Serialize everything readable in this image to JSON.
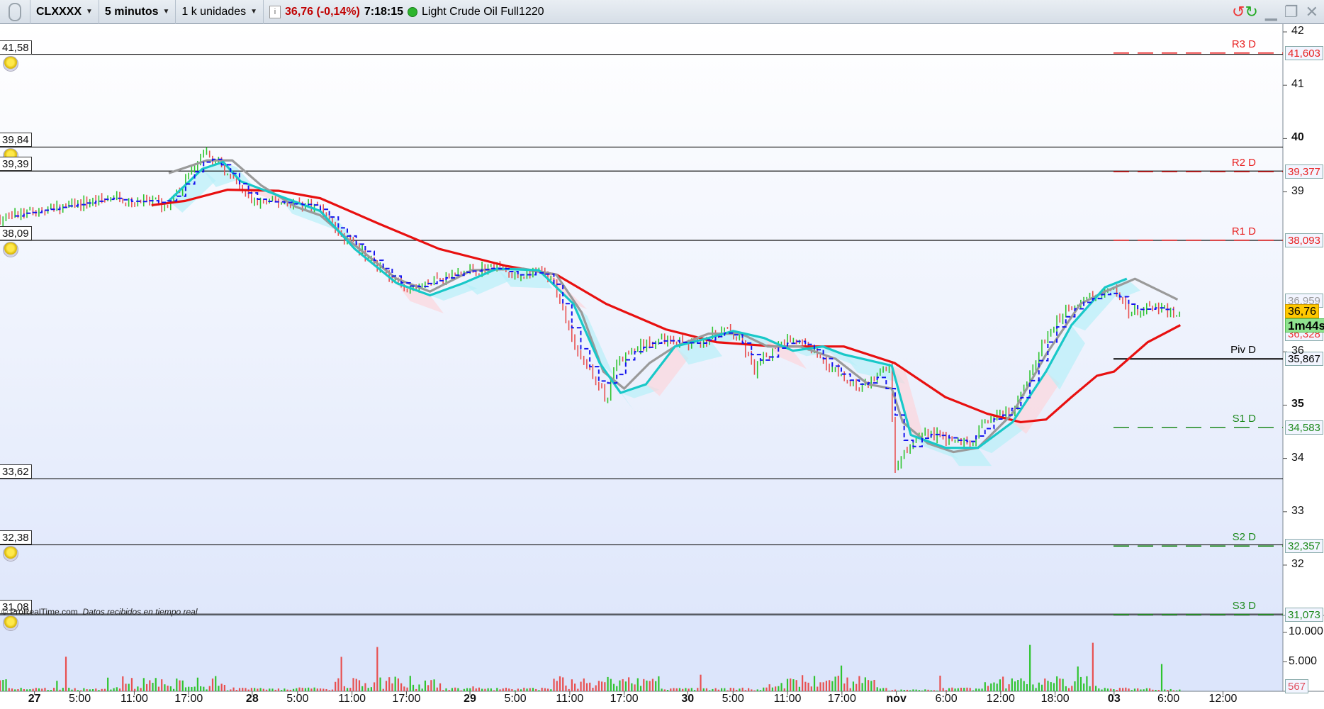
{
  "toolbar": {
    "symbol": "CLXXXX",
    "timeframe": "5 minutos",
    "units": "1 k unidades",
    "price": "36,76 (-0,14%)",
    "time": "7:18:15",
    "instrument": "Light Crude Oil Full1220"
  },
  "icons": {
    "refresh": "refresh-icon",
    "minimize": "minimize-icon",
    "restore": "restore-icon",
    "close": "close-icon"
  },
  "left_levels": [
    {
      "label": "41,58",
      "price": 41.58,
      "bell": true
    },
    {
      "label": "39,84",
      "price": 39.84,
      "bell": true
    },
    {
      "label": "39,39",
      "price": 39.39,
      "bell": false
    },
    {
      "label": "38,09",
      "price": 38.09,
      "bell": true
    },
    {
      "label": "33,62",
      "price": 33.62,
      "bell": false
    },
    {
      "label": "32,38",
      "price": 32.38,
      "bell": true
    },
    {
      "label": "31,08",
      "price": 31.08,
      "bell": true
    }
  ],
  "pivots": [
    {
      "name": "R3 D",
      "value": "41,603",
      "price": 41.603,
      "color": "#e82020",
      "style": "dash"
    },
    {
      "name": "R2 D",
      "value": "39,377",
      "price": 39.377,
      "color": "#e82020",
      "style": "dash"
    },
    {
      "name": "R1 D",
      "value": "38,093",
      "price": 38.093,
      "color": "#e82020",
      "style": "dash"
    },
    {
      "name": "Piv D",
      "value": "35,867",
      "price": 35.867,
      "color": "#000000",
      "style": "solid"
    },
    {
      "name": "S1 D",
      "value": "34,583",
      "price": 34.583,
      "color": "#1e8a1e",
      "style": "dash"
    },
    {
      "name": "S2 D",
      "value": "32,357",
      "price": 32.357,
      "color": "#1e8a1e",
      "style": "dash"
    },
    {
      "name": "S3 D",
      "value": "31,073",
      "price": 31.073,
      "color": "#1e8a1e",
      "style": "dash"
    }
  ],
  "price_labels": {
    "ma_grey": "36,959",
    "last": "36,76",
    "countdown": "1m44s",
    "ma_red": "36,328"
  },
  "watermark": "© ProRealTime.com",
  "watermark_note": "Datos recibidos en tiempo real",
  "chart_data": {
    "type": "candlestick",
    "ylim": [
      31,
      42.1
    ],
    "y_ticks": [
      {
        "v": 42,
        "label": "42"
      },
      {
        "v": 41,
        "label": "41"
      },
      {
        "v": 40,
        "label": "40",
        "bold": true
      },
      {
        "v": 39,
        "label": "39"
      },
      {
        "v": 36,
        "label": "36"
      },
      {
        "v": 35,
        "label": "35",
        "bold": true
      },
      {
        "v": 34,
        "label": "34"
      },
      {
        "v": 33,
        "label": "33"
      },
      {
        "v": 32,
        "label": "32"
      }
    ],
    "x_ticks": [
      {
        "x": 0,
        "label": "27",
        "bold": true
      },
      {
        "x": 5,
        "label": "5:00"
      },
      {
        "x": 11,
        "label": "11:00"
      },
      {
        "x": 17,
        "label": "17:00"
      },
      {
        "x": 24,
        "label": "28",
        "bold": true
      },
      {
        "x": 29,
        "label": "5:00"
      },
      {
        "x": 35,
        "label": "11:00"
      },
      {
        "x": 41,
        "label": "17:00"
      },
      {
        "x": 48,
        "label": "29",
        "bold": true
      },
      {
        "x": 53,
        "label": "5:00"
      },
      {
        "x": 59,
        "label": "11:00"
      },
      {
        "x": 65,
        "label": "17:00"
      },
      {
        "x": 72,
        "label": "30",
        "bold": true
      },
      {
        "x": 77,
        "label": "5:00"
      },
      {
        "x": 83,
        "label": "11:00"
      },
      {
        "x": 89,
        "label": "17:00"
      },
      {
        "x": 95,
        "label": "nov",
        "bold": true
      },
      {
        "x": 100.5,
        "label": "6:00"
      },
      {
        "x": 106.5,
        "label": "12:00"
      },
      {
        "x": 112.5,
        "label": "18:00"
      },
      {
        "x": 119,
        "label": "03",
        "bold": true
      },
      {
        "x": 125,
        "label": "6:00"
      },
      {
        "x": 131,
        "label": "12:00"
      }
    ],
    "price": [
      [
        -3.8,
        38.5
      ],
      [
        1.7,
        38.67
      ],
      [
        8.3,
        38.88
      ],
      [
        12.9,
        38.8
      ],
      [
        14.8,
        38.72
      ],
      [
        17.1,
        39.35
      ],
      [
        19,
        39.7
      ],
      [
        20.4,
        39.5
      ],
      [
        21.8,
        39.2
      ],
      [
        24.1,
        38.8
      ],
      [
        28.3,
        38.8
      ],
      [
        31.5,
        38.72
      ],
      [
        33.4,
        38.24
      ],
      [
        36.2,
        37.85
      ],
      [
        38.9,
        37.45
      ],
      [
        40.8,
        37.13
      ],
      [
        44.6,
        37.37
      ],
      [
        48.2,
        37.53
      ],
      [
        51,
        37.6
      ],
      [
        52.9,
        37.37
      ],
      [
        55.6,
        37.53
      ],
      [
        57.5,
        37.2
      ],
      [
        58.9,
        36.42
      ],
      [
        60.3,
        35.79
      ],
      [
        61.7,
        35.55
      ],
      [
        63,
        35.07
      ],
      [
        64,
        35.79
      ],
      [
        66.8,
        36.1
      ],
      [
        69.6,
        36.26
      ],
      [
        72.4,
        36.1
      ],
      [
        76.1,
        36.42
      ],
      [
        77.9,
        36.18
      ],
      [
        79.4,
        35.63
      ],
      [
        80.8,
        35.95
      ],
      [
        83.1,
        36.26
      ],
      [
        85.4,
        36.1
      ],
      [
        88.3,
        35.63
      ],
      [
        91,
        35.31
      ],
      [
        94.3,
        35.71
      ],
      [
        94.8,
        33.73
      ],
      [
        95.7,
        34.05
      ],
      [
        97.6,
        34.52
      ],
      [
        100.4,
        34.37
      ],
      [
        103.2,
        34.28
      ],
      [
        105,
        34.76
      ],
      [
        107.8,
        34.84
      ],
      [
        109.7,
        35.63
      ],
      [
        111.5,
        36.26
      ],
      [
        113.4,
        36.74
      ],
      [
        116.2,
        37.06
      ],
      [
        119,
        37.13
      ],
      [
        120.8,
        36.74
      ],
      [
        123.6,
        36.82
      ],
      [
        126,
        36.71
      ]
    ],
    "series": [
      {
        "name": "ma_red",
        "color": "#e81010",
        "points": [
          [
            12.9,
            38.75
          ],
          [
            16.6,
            38.83
          ],
          [
            21.3,
            39.04
          ],
          [
            26.9,
            39.02
          ],
          [
            31.5,
            38.88
          ],
          [
            38,
            38.4
          ],
          [
            44.6,
            37.93
          ],
          [
            52,
            37.61
          ],
          [
            57.5,
            37.45
          ],
          [
            63,
            36.9
          ],
          [
            69.6,
            36.42
          ],
          [
            75.2,
            36.18
          ],
          [
            81.7,
            36.1
          ],
          [
            89.2,
            36.1
          ],
          [
            94.8,
            35.79
          ],
          [
            100.4,
            35.15
          ],
          [
            105,
            34.84
          ],
          [
            108.7,
            34.68
          ],
          [
            111.5,
            34.73
          ],
          [
            114.3,
            35.15
          ],
          [
            117.1,
            35.55
          ],
          [
            119,
            35.63
          ],
          [
            122.7,
            36.18
          ],
          [
            126.3,
            36.5
          ]
        ]
      },
      {
        "name": "ma_grey",
        "color": "#9a9a9a",
        "points": [
          [
            14.8,
            39.35
          ],
          [
            19,
            39.59
          ],
          [
            21.8,
            39.59
          ],
          [
            25,
            39.12
          ],
          [
            28.8,
            38.72
          ],
          [
            31.5,
            38.56
          ],
          [
            35.3,
            38.0
          ],
          [
            39.9,
            37.37
          ],
          [
            43.6,
            37.13
          ],
          [
            48.2,
            37.53
          ],
          [
            53.9,
            37.56
          ],
          [
            57.5,
            37.45
          ],
          [
            60.3,
            36.74
          ],
          [
            62.7,
            35.63
          ],
          [
            65,
            35.31
          ],
          [
            67.8,
            35.79
          ],
          [
            70.6,
            36.1
          ],
          [
            74.3,
            36.34
          ],
          [
            77.9,
            36.34
          ],
          [
            80.8,
            36.1
          ],
          [
            84.4,
            36.1
          ],
          [
            88.3,
            35.87
          ],
          [
            91.9,
            35.39
          ],
          [
            94.5,
            35.31
          ],
          [
            95.7,
            34.68
          ],
          [
            98.5,
            34.28
          ],
          [
            101.3,
            34.12
          ],
          [
            104,
            34.2
          ],
          [
            107.8,
            34.84
          ],
          [
            111.5,
            35.95
          ],
          [
            115.3,
            36.9
          ],
          [
            118,
            37.13
          ],
          [
            121.3,
            37.37
          ],
          [
            126,
            36.98
          ]
        ]
      },
      {
        "name": "ma_cyan",
        "color": "#18c8c8",
        "points": [
          [
            14.8,
            38.83
          ],
          [
            18.5,
            39.43
          ],
          [
            20.8,
            39.56
          ],
          [
            22.7,
            39.2
          ],
          [
            26.9,
            38.93
          ],
          [
            31.5,
            38.64
          ],
          [
            35.3,
            37.93
          ],
          [
            39.9,
            37.29
          ],
          [
            43.6,
            37.06
          ],
          [
            47.3,
            37.29
          ],
          [
            51,
            37.56
          ],
          [
            55.6,
            37.53
          ],
          [
            59.4,
            36.9
          ],
          [
            62.3,
            35.79
          ],
          [
            64.6,
            35.23
          ],
          [
            67.4,
            35.39
          ],
          [
            70.6,
            36.1
          ],
          [
            74.3,
            36.26
          ],
          [
            77,
            36.39
          ],
          [
            80.4,
            36.26
          ],
          [
            83.6,
            36.02
          ],
          [
            86.9,
            36.1
          ],
          [
            89.2,
            35.95
          ],
          [
            94.5,
            35.74
          ],
          [
            96.6,
            34.44
          ],
          [
            100.4,
            34.2
          ],
          [
            104,
            34.2
          ],
          [
            107.8,
            34.68
          ],
          [
            111.5,
            35.63
          ],
          [
            114.3,
            36.5
          ],
          [
            118,
            37.21
          ],
          [
            120.4,
            37.37
          ]
        ]
      }
    ],
    "volume_ticks": [
      {
        "v": 10000,
        "label": "10.000"
      },
      {
        "v": 5000,
        "label": "5.000"
      }
    ],
    "volume_last": {
      "v": 567,
      "label": "567"
    }
  }
}
